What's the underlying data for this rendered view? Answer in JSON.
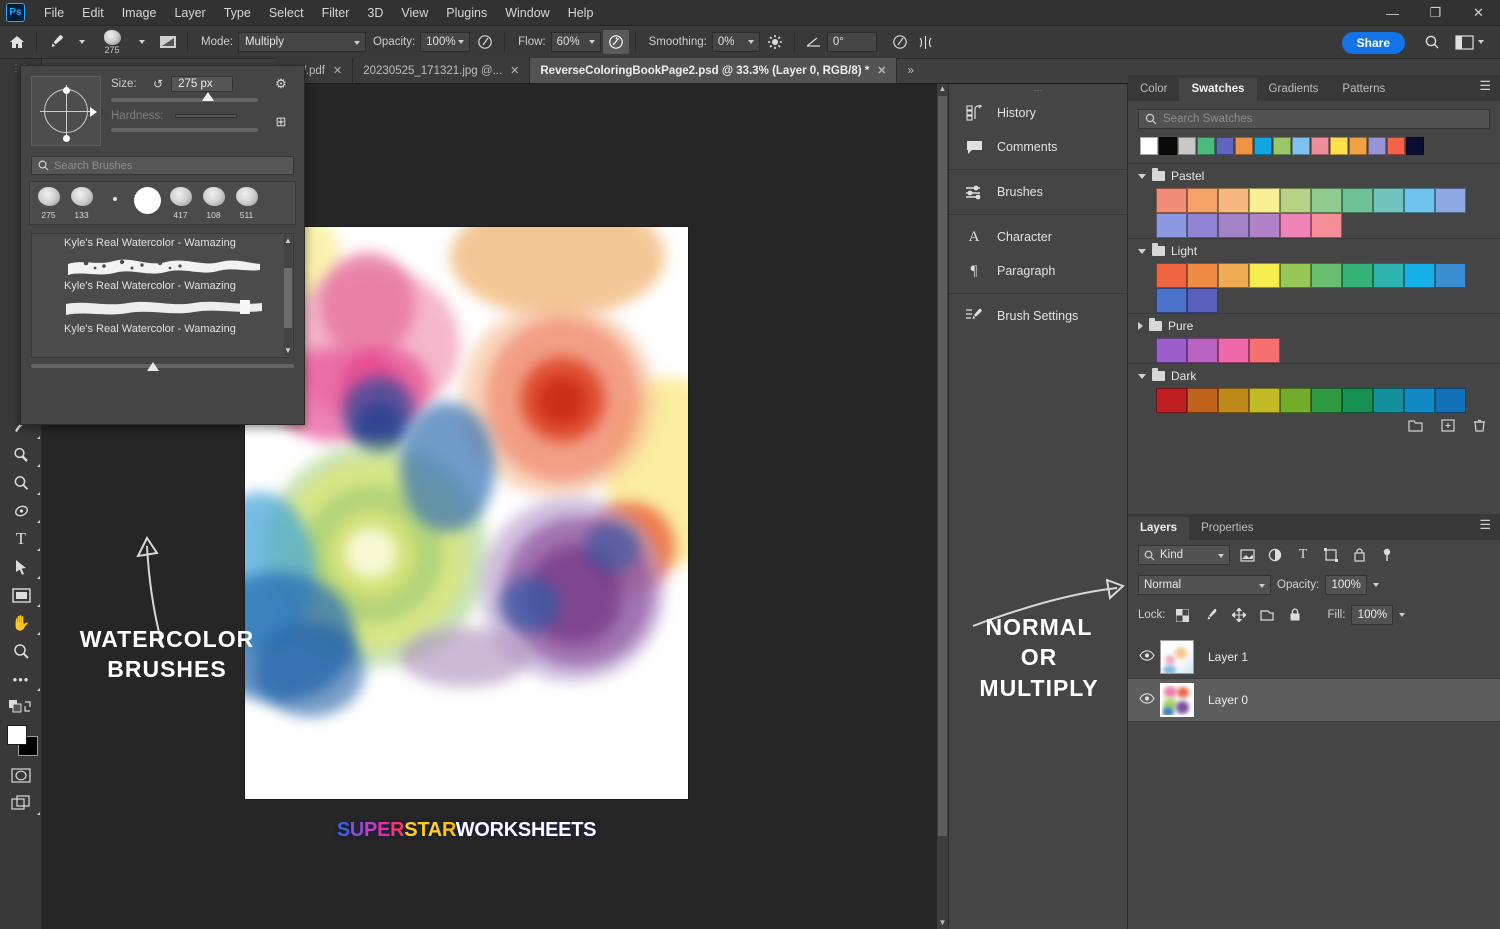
{
  "app": {
    "logo": "Ps",
    "menus": [
      "File",
      "Edit",
      "Image",
      "Layer",
      "Type",
      "Select",
      "Filter",
      "3D",
      "View",
      "Plugins",
      "Window",
      "Help"
    ],
    "window_controls": [
      {
        "name": "minimize",
        "glyph": "—"
      },
      {
        "name": "restore",
        "glyph": "❐"
      },
      {
        "name": "close",
        "glyph": "✕"
      }
    ]
  },
  "options_bar": {
    "home_icon": "home-icon",
    "tool_icon": "brush-tool-icon",
    "brush_size_badge": "275",
    "brush_preset_picker_icon": "brush-preset-icon",
    "brush_settings_icon": "brush-settings-panel-icon",
    "mode_label": "Mode:",
    "mode_value": "Multiply",
    "opacity_label": "Opacity:",
    "opacity_value": "100%",
    "pressure_opacity_icon": "pressure-opacity-icon",
    "flow_label": "Flow:",
    "flow_value": "60%",
    "airbrush_icon": "airbrush-icon",
    "smoothing_label": "Smoothing:",
    "smoothing_value": "0%",
    "smoothing_gear_icon": "smoothing-options-icon",
    "angle_icon": "brush-angle-icon",
    "angle_value": "0°",
    "pressure_size_icon": "pressure-size-icon",
    "symmetry_icon": "symmetry-icon",
    "share_label": "Share",
    "search_icon": "search-icon",
    "workspace_icon": "workspace-switcher-icon"
  },
  "brush_flyout": {
    "size_label": "Size:",
    "size_value": "275 px",
    "reset_icon": "reset-brush-icon",
    "gear_icon": "gear-icon",
    "new_preset_icon": "new-preset-icon",
    "hardness_label": "Hardness:",
    "hardness_value": "",
    "search_placeholder": "Search Brushes",
    "presets": [
      {
        "label": "275",
        "selected": false,
        "shape": "blob"
      },
      {
        "label": "133",
        "selected": false,
        "shape": "blob"
      },
      {
        "label": "",
        "selected": false,
        "shape": "dot"
      },
      {
        "label": "",
        "selected": true,
        "shape": "round"
      },
      {
        "label": "417",
        "selected": false,
        "shape": "blob"
      },
      {
        "label": "108",
        "selected": false,
        "shape": "blob"
      },
      {
        "label": "511",
        "selected": false,
        "shape": "blob"
      }
    ],
    "brush_list": [
      {
        "name": "Kyle's Real Watercolor - Wamazing",
        "stroke": "speckled"
      },
      {
        "name": "Kyle's Real Watercolor - Wamazing",
        "stroke": "solid"
      },
      {
        "name": "Kyle's Real Watercolor - Wamazing",
        "stroke": "none"
      }
    ]
  },
  "tabs": {
    "overflow_left_icon": "tabs-overflow-left-icon",
    "overflow_right_icon": "tabs-overflow-right-icon",
    "items": [
      {
        "title": "...W.pdf",
        "active": false
      },
      {
        "title": "20230525_171321.jpg @...",
        "active": false
      },
      {
        "title": "ReverseColoringBookPage2.psd @ 33.3% (Layer 0, RGB/8) *",
        "active": true
      }
    ]
  },
  "toolbar": {
    "tools": [
      {
        "name": "pen-tool",
        "glyph": "✒",
        "has_submenu": true
      },
      {
        "name": "dodge-tool",
        "glyph": "◓",
        "has_submenu": true
      },
      {
        "name": "blur-tool",
        "glyph": "◌",
        "has_submenu": true
      },
      {
        "name": "sponge-tool",
        "glyph": "◉",
        "has_submenu": true
      },
      {
        "name": "type-tool",
        "glyph": "T",
        "has_submenu": true
      },
      {
        "name": "path-selection-tool",
        "glyph": "➤",
        "has_submenu": true
      },
      {
        "name": "rectangle-tool",
        "glyph": "▭",
        "has_submenu": true
      },
      {
        "name": "hand-tool",
        "glyph": "✋",
        "has_submenu": true
      },
      {
        "name": "zoom-tool",
        "glyph": "🔍",
        "has_submenu": false
      },
      {
        "name": "edit-toolbar",
        "glyph": "•••",
        "has_submenu": true
      }
    ],
    "default_colors_icon": "default-colors-icon",
    "swap-colors-icon": "swap-colors-icon",
    "foreground_color": "#ffffff",
    "background_color": "#000000",
    "quick_mask_icon": "quick-mask-icon",
    "screen_mode_icon": "screen-mode-icon"
  },
  "canvas": {
    "zoom": "33.3%",
    "annotation_left": "WATERCOLOR\nBRUSHES",
    "annotation_left_line1": "WATERCOLOR",
    "annotation_left_line2": "BRUSHES",
    "annotation_right_line1": "NORMAL",
    "annotation_right_line2": "OR",
    "annotation_right_line3": "MULTIPLY",
    "arrow_left_icon": "curved-arrow-up-icon",
    "arrow_right_icon": "curved-arrow-right-icon",
    "logo_parts": [
      {
        "text": "SUPER",
        "color": "#3b5fd0"
      },
      {
        "text": "STAR",
        "color": "#ffd01e"
      },
      {
        "text": "WORKSHEETS",
        "color": "#ffffff"
      }
    ],
    "logo_letters": [
      {
        "ch": "S",
        "color": "#3f63d6"
      },
      {
        "ch": "U",
        "color": "#8b4fd1"
      },
      {
        "ch": "P",
        "color": "#c23fc0"
      },
      {
        "ch": "E",
        "color": "#e32fa0"
      },
      {
        "ch": "R",
        "color": "#ef3b63"
      },
      {
        "ch": "S",
        "color": "#ffd21e"
      },
      {
        "ch": "T",
        "color": "#ffcc15"
      },
      {
        "ch": "A",
        "color": "#ffd21e"
      },
      {
        "ch": "R",
        "color": "#ffc20e"
      },
      {
        "ch": "W",
        "color": "#ffffff"
      },
      {
        "ch": "O",
        "color": "#ffffff"
      },
      {
        "ch": "R",
        "color": "#ffffff"
      },
      {
        "ch": "K",
        "color": "#ffffff"
      },
      {
        "ch": "S",
        "color": "#ffffff"
      },
      {
        "ch": "H",
        "color": "#ffffff"
      },
      {
        "ch": "E",
        "color": "#ffffff"
      },
      {
        "ch": "E",
        "color": "#ffffff"
      },
      {
        "ch": "T",
        "color": "#ffffff"
      },
      {
        "ch": "S",
        "color": "#ffffff"
      }
    ]
  },
  "dock": {
    "groups": [
      [
        {
          "label": "History",
          "icon": "history-icon"
        },
        {
          "label": "Comments",
          "icon": "comments-icon"
        }
      ],
      [
        {
          "label": "Brushes",
          "icon": "brushes-icon"
        }
      ],
      [
        {
          "label": "Character",
          "icon": "character-icon"
        },
        {
          "label": "Paragraph",
          "icon": "paragraph-icon"
        }
      ],
      [
        {
          "label": "Brush Settings",
          "icon": "brush-settings-icon"
        }
      ]
    ]
  },
  "swatches_panel": {
    "tabs": [
      {
        "label": "Color",
        "active": false
      },
      {
        "label": "Swatches",
        "active": true
      },
      {
        "label": "Gradients",
        "active": false
      },
      {
        "label": "Patterns",
        "active": false
      }
    ],
    "menu_icon": "panel-menu-icon",
    "search_placeholder": "Search Swatches",
    "search_icon": "search-icon",
    "recent": [
      "#ffffff",
      "#0a0a0a",
      "#c6c9c4",
      "#4cb97d",
      "#6165c0",
      "#ee9246",
      "#0fa7e0",
      "#9ac769",
      "#7fc2ee",
      "#ef8d9c",
      "#ffe04a",
      "#efa144",
      "#9a94d6",
      "#f4624a",
      "#0d0d33"
    ],
    "groups": [
      {
        "name": "Pastel",
        "expanded": true,
        "colors": [
          "#f18d76",
          "#f5a269",
          "#f5b87f",
          "#f9ef94",
          "#b7d284",
          "#8fcb8e",
          "#6ec295",
          "#72c3bd",
          "#6ec3ef",
          "#8fa9e2",
          "#8b9ae0",
          "#9183d4",
          "#a183c6",
          "#b383ca",
          "#f083b8",
          "#f58e97"
        ]
      },
      {
        "name": "Light",
        "expanded": true,
        "colors": [
          "#ef6542",
          "#ef8a42",
          "#eeab52",
          "#f5ec4d",
          "#97c855",
          "#69bf6f",
          "#35b377",
          "#2fb3b0",
          "#16b0e9",
          "#3b8ed2",
          "#4b73cc",
          "#5a5fbc"
        ]
      },
      {
        "name": "Pure",
        "expanded": false,
        "colors": [
          "#9b5ecb",
          "#bb63c2",
          "#ef69aa",
          "#f5706e"
        ]
      },
      {
        "name": "Dark",
        "expanded": true,
        "colors": [
          "#c01f22",
          "#c1621d",
          "#c08a1a",
          "#c3bb25",
          "#74ad2c",
          "#2e9a43",
          "#169151",
          "#13909b",
          "#1089c7",
          "#1170b6"
        ]
      }
    ],
    "footer_icons": [
      "new-group-icon",
      "new-swatch-icon",
      "delete-swatch-icon"
    ]
  },
  "layers_panel": {
    "tabs": [
      {
        "label": "Layers",
        "active": true
      },
      {
        "label": "Properties",
        "active": false
      }
    ],
    "menu_icon": "panel-menu-icon",
    "filter_label": "Kind",
    "filter_icons": [
      "filter-pixel-icon",
      "filter-adjustment-icon",
      "filter-type-icon",
      "filter-shape-icon",
      "filter-smart-icon",
      "filter-toggle-icon"
    ],
    "blend_mode": "Normal",
    "opacity_label": "Opacity:",
    "opacity_value": "100%",
    "lock_label": "Lock:",
    "lock_icons": [
      "lock-transparency-icon",
      "lock-image-icon",
      "lock-position-icon",
      "lock-artboard-icon",
      "lock-all-icon"
    ],
    "fill_label": "Fill:",
    "fill_value": "100%",
    "layers": [
      {
        "name": "Layer 1",
        "visible": true,
        "selected": false,
        "thumb": "light"
      },
      {
        "name": "Layer 0",
        "visible": true,
        "selected": true,
        "thumb": "art"
      }
    ]
  }
}
